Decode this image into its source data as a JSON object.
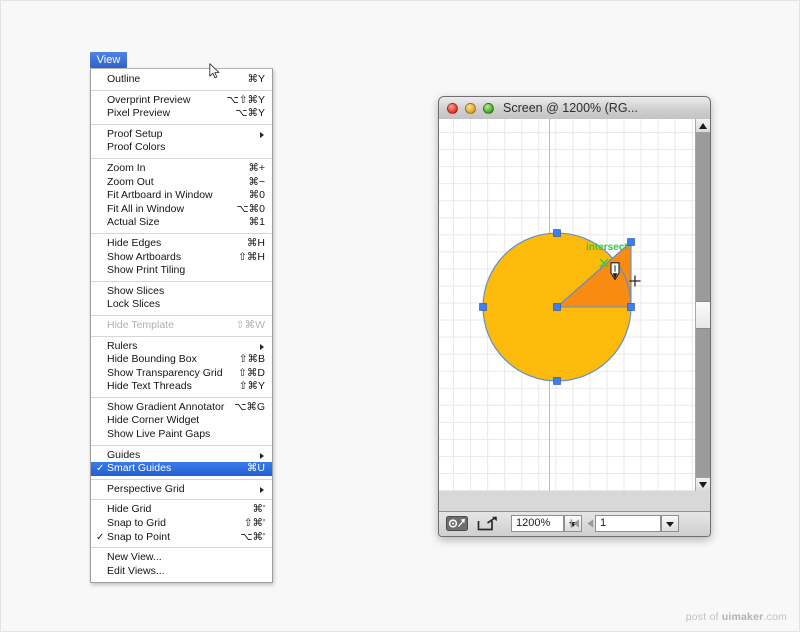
{
  "menu": {
    "title": "View",
    "sections": [
      {
        "items": [
          {
            "label": "Outline",
            "key": "⌘Y"
          }
        ]
      },
      {
        "items": [
          {
            "label": "Overprint Preview",
            "key": "⌥⇧⌘Y"
          },
          {
            "label": "Pixel Preview",
            "key": "⌥⌘Y"
          }
        ]
      },
      {
        "items": [
          {
            "label": "Proof Setup",
            "submenu": true
          },
          {
            "label": "Proof Colors"
          }
        ]
      },
      {
        "items": [
          {
            "label": "Zoom In",
            "key": "⌘+"
          },
          {
            "label": "Zoom Out",
            "key": "⌘−"
          },
          {
            "label": "Fit Artboard in Window",
            "key": "⌘0"
          },
          {
            "label": "Fit All in Window",
            "key": "⌥⌘0"
          },
          {
            "label": "Actual Size",
            "key": "⌘1"
          }
        ]
      },
      {
        "items": [
          {
            "label": "Hide Edges",
            "key": "⌘H"
          },
          {
            "label": "Show Artboards",
            "key": "⇧⌘H"
          },
          {
            "label": "Show Print Tiling"
          }
        ]
      },
      {
        "items": [
          {
            "label": "Show Slices"
          },
          {
            "label": "Lock Slices"
          }
        ]
      },
      {
        "items": [
          {
            "label": "Hide Template",
            "key": "⇧⌘W",
            "disabled": true
          }
        ]
      },
      {
        "items": [
          {
            "label": "Rulers",
            "submenu": true
          },
          {
            "label": "Hide Bounding Box",
            "key": "⇧⌘B"
          },
          {
            "label": "Show Transparency Grid",
            "key": "⇧⌘D"
          },
          {
            "label": "Hide Text Threads",
            "key": "⇧⌘Y"
          }
        ]
      },
      {
        "items": [
          {
            "label": "Show Gradient Annotator",
            "key": "⌥⌘G"
          },
          {
            "label": "Hide Corner Widget"
          },
          {
            "label": "Show Live Paint Gaps"
          }
        ]
      },
      {
        "items": [
          {
            "label": "Guides",
            "submenu": true
          },
          {
            "label": "Smart Guides",
            "key": "⌘U",
            "checked": true,
            "selected": true
          }
        ]
      },
      {
        "items": [
          {
            "label": "Perspective Grid",
            "submenu": true
          }
        ]
      },
      {
        "items": [
          {
            "label": "Hide Grid",
            "key": "⌘'"
          },
          {
            "label": "Snap to Grid",
            "key": "⇧⌘'"
          },
          {
            "label": "Snap to Point",
            "key": "⌥⌘'",
            "checked": true
          }
        ]
      },
      {
        "items": [
          {
            "label": "New View..."
          },
          {
            "label": "Edit Views..."
          }
        ]
      }
    ]
  },
  "document_window": {
    "title": "Screen @ 1200% (RG...",
    "traffic_lights": {
      "close": "close-button",
      "minimize": "minimize-button",
      "zoom": "zoom-button"
    },
    "statusbar": {
      "prefs_icon": "preferences-icon",
      "share_icon": "share-export-icon",
      "zoom_value": "1200%",
      "page_value": "1",
      "first_page_icon": "first-page-icon",
      "prev_page_icon": "previous-page-icon",
      "zoom_dropdown_icon": "chevron-down-icon",
      "page_dropdown_icon": "chevron-down-icon"
    },
    "scrollbar": {
      "up_icon": "scroll-up-arrow",
      "down_icon": "scroll-down-arrow"
    },
    "artwork": {
      "smart_guide_label": "intersect",
      "smart_guide_color": "#2ecc40",
      "circle_fill": "#FCBA0A",
      "wedge_fill": "#F98B13",
      "path_stroke": "#5b8ed6",
      "anchor_color": "#3d7ef0",
      "cursor": "pen-tool-cursor"
    }
  },
  "watermark": {
    "prefix": "post of ",
    "brand": "uimaker",
    "suffix": ".com"
  }
}
